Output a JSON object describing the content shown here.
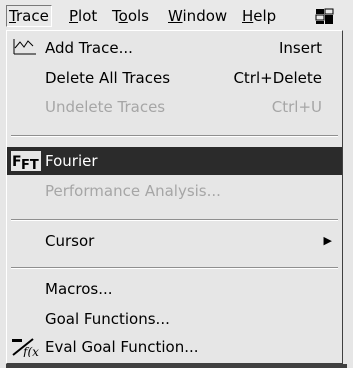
{
  "menubar": {
    "items": [
      {
        "label": "Trace",
        "ul": "T"
      },
      {
        "label": "Plot",
        "ul": "P"
      },
      {
        "label": "Tools",
        "ul": "o"
      },
      {
        "label": "Window",
        "ul": "W"
      },
      {
        "label": "Help",
        "ul": "H"
      }
    ]
  },
  "menu": {
    "add_trace": {
      "label": "Add Trace...",
      "accel": "Insert"
    },
    "delete_all": {
      "label": "Delete All Traces",
      "accel": "Ctrl+Delete"
    },
    "undelete": {
      "label": "Undelete Traces",
      "accel": "Ctrl+U"
    },
    "fourier": {
      "label": "Fourier"
    },
    "performance": {
      "label": "Performance Analysis..."
    },
    "cursor": {
      "label": "Cursor"
    },
    "macros": {
      "label": "Macros..."
    },
    "goal_functions": {
      "label": "Goal Functions..."
    },
    "eval_goal": {
      "label": "Eval Goal Function..."
    }
  },
  "colors": {
    "menu_bg": "#e6e6e6",
    "highlight": "#2b2b2b",
    "disabled": "#a6a6a6"
  }
}
